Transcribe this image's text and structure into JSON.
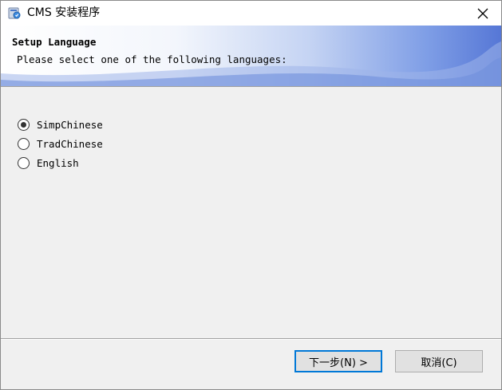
{
  "window": {
    "title": "CMS 安装程序"
  },
  "header": {
    "title": "Setup Language",
    "subtitle": "Please select one of the following languages:"
  },
  "languages": {
    "options": [
      "SimpChinese",
      "TradChinese",
      "English"
    ],
    "selected": "SimpChinese"
  },
  "buttons": {
    "next_label": "下一步(N) >",
    "cancel_label": "取消(C)"
  },
  "colors": {
    "accent": "#0078d7",
    "header_gradient_end": "#5677d6"
  },
  "icons": {
    "app": "installer-icon",
    "close": "close-icon"
  }
}
